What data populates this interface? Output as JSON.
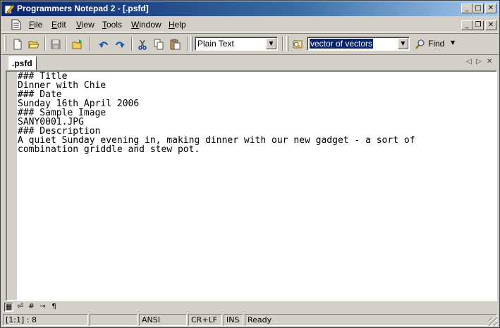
{
  "titlebar": {
    "title": "Programmers Notepad 2 - [.psfd]",
    "app_icon": "pencil-notepad-icon",
    "minimize": "_",
    "maximize": "□",
    "close": "✕"
  },
  "menubar": {
    "doc_icon": "document-icon",
    "items": [
      {
        "key": "F",
        "rest": "ile"
      },
      {
        "key": "E",
        "rest": "dit"
      },
      {
        "key": "V",
        "rest": "iew"
      },
      {
        "key": "T",
        "rest": "ools"
      },
      {
        "key": "W",
        "rest": "indow"
      },
      {
        "key": "H",
        "rest": "elp"
      }
    ],
    "mdi_minimize": "_",
    "mdi_restore": "❐",
    "mdi_close": "✕"
  },
  "toolbar": {
    "scheme_value": "Plain Text",
    "search_value": "vector of vectors",
    "find_label": "Find",
    "dropdown_glyph": "▼",
    "find_arrow": "▼"
  },
  "tabs": {
    "active": ".psfd",
    "nav_prev": "◁",
    "nav_next": "▷",
    "close": "✕"
  },
  "editor": {
    "lines": [
      "### Title",
      "Dinner with Chie",
      "### Date",
      "Sunday 16th April 2006",
      "### Sample Image",
      "SANY0001.JPG",
      "### Description",
      "A quiet Sunday evening in, making dinner with our new gadget - a sort of",
      "combination griddle and stew pot."
    ]
  },
  "minibar": {
    "buttons": [
      "▦",
      "⏎",
      "#",
      "→",
      "¶"
    ]
  },
  "statusbar": {
    "position": "[1:1] : 8",
    "blank": "",
    "encoding": "ANSI",
    "line_ending": "CR+LF",
    "insert_mode": "INS",
    "status": "Ready"
  },
  "colors": {
    "titlebar_start": "#0a246a",
    "titlebar_end": "#a6caf0",
    "chrome": "#d4d0c8",
    "selection": "#0a246a"
  }
}
